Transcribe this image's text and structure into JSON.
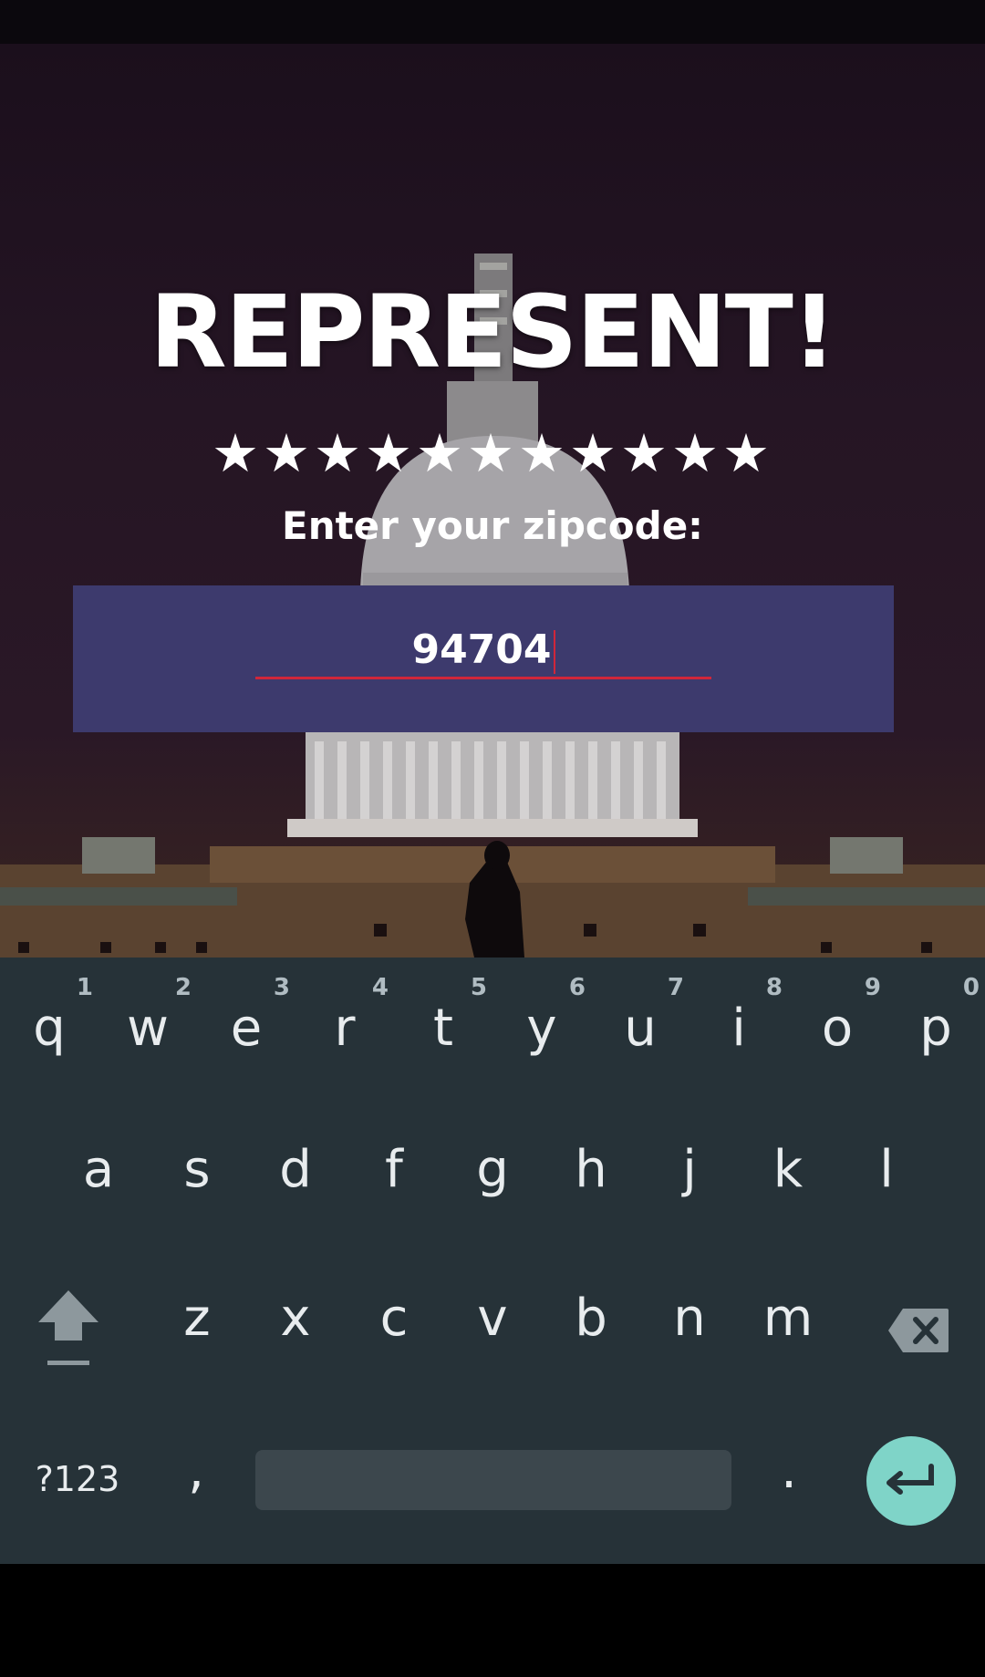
{
  "app": {
    "title": "REPRESENT!",
    "stars": "★★★★★★★★★★★",
    "prompt": "Enter your zipcode:"
  },
  "zip_input": {
    "value": "94704",
    "accent_color": "#d0263a",
    "panel_color": "#3d3a6d"
  },
  "keyboard": {
    "row1": [
      {
        "ch": "q",
        "hint": "1"
      },
      {
        "ch": "w",
        "hint": "2"
      },
      {
        "ch": "e",
        "hint": "3"
      },
      {
        "ch": "r",
        "hint": "4"
      },
      {
        "ch": "t",
        "hint": "5"
      },
      {
        "ch": "y",
        "hint": "6"
      },
      {
        "ch": "u",
        "hint": "7"
      },
      {
        "ch": "i",
        "hint": "8"
      },
      {
        "ch": "o",
        "hint": "9"
      },
      {
        "ch": "p",
        "hint": "0"
      }
    ],
    "row2": [
      "a",
      "s",
      "d",
      "f",
      "g",
      "h",
      "j",
      "k",
      "l"
    ],
    "row3": [
      "z",
      "x",
      "c",
      "v",
      "b",
      "n",
      "m"
    ],
    "symbols_label": "?123",
    "comma_label": ",",
    "period_label": ".",
    "shift_icon": "shift-icon",
    "backspace_icon": "backspace-icon",
    "enter_icon": "enter-icon",
    "background_color": "#263238",
    "enter_color": "#7fd4c8"
  }
}
